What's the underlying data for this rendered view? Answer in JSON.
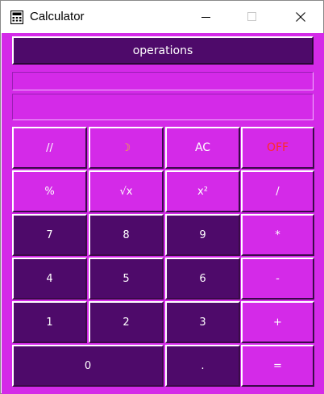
{
  "window": {
    "title": "Calculator"
  },
  "colors": {
    "panel": "#d42ae8",
    "dark_key": "#4e0a6a",
    "moon": "#f5c21b",
    "off": "#ff2a2a"
  },
  "operations_label": "operations",
  "display": {
    "expression": "",
    "result": ""
  },
  "keys": {
    "floor_div": "//",
    "theme": "☽",
    "ac": "AC",
    "off": "OFF",
    "percent": "%",
    "sqrt": "√x",
    "square": "x²",
    "divide": "/",
    "seven": "7",
    "eight": "8",
    "nine": "9",
    "multiply": "*",
    "four": "4",
    "five": "5",
    "six": "6",
    "minus": "-",
    "one": "1",
    "two": "2",
    "three": "3",
    "plus": "+",
    "zero": "0",
    "dot": ".",
    "equals": "="
  }
}
